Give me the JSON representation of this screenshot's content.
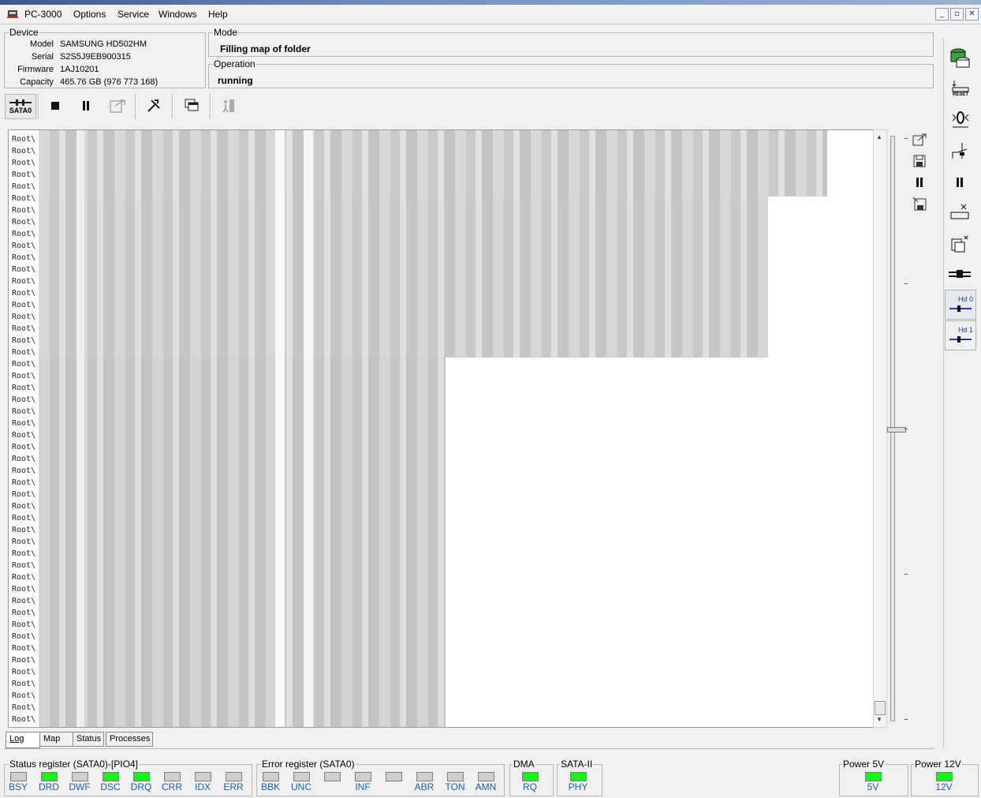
{
  "app": {
    "title": "PC-3000"
  },
  "menu": [
    "Options",
    "Service",
    "Windows",
    "Help"
  ],
  "window_buttons": [
    "_",
    "▫",
    "✕"
  ],
  "device": {
    "legend": "Device",
    "fields": [
      {
        "key": "Model",
        "value": "SAMSUNG HD502HM"
      },
      {
        "key": "Serial",
        "value": "S2S5J9EB900315"
      },
      {
        "key": "Firmware",
        "value": "1AJ10201"
      },
      {
        "key": "Capacity",
        "value": "465.76 GB (976 773 168)"
      }
    ]
  },
  "mode": {
    "legend": "Mode",
    "value": "Filling map of folder"
  },
  "operation": {
    "legend": "Operation",
    "value": "running"
  },
  "toolbar": {
    "port_label": "SATA0",
    "icons": [
      "sata-port-icon",
      "stop-icon",
      "pause-icon",
      "export-icon",
      "tools-icon",
      "windows-icon",
      "exit-icon"
    ]
  },
  "log": {
    "line_prefix": "Root\\",
    "line_count": 50
  },
  "tabs": [
    "Log",
    "Map",
    "Status",
    "Processes"
  ],
  "right_panel": {
    "hd0": "Hd 0",
    "hd1": "Hd 1",
    "reset": "RESET"
  },
  "status_register": {
    "legend": "Status register (SATA0)-[PIO4]",
    "leds": [
      {
        "label": "BSY",
        "on": false
      },
      {
        "label": "DRD",
        "on": true
      },
      {
        "label": "DWF",
        "on": false
      },
      {
        "label": "DSC",
        "on": true
      },
      {
        "label": "DRQ",
        "on": true
      },
      {
        "label": "CRR",
        "on": false
      },
      {
        "label": "IDX",
        "on": false
      },
      {
        "label": "ERR",
        "on": false
      }
    ]
  },
  "error_register": {
    "legend": "Error register (SATA0)",
    "leds": [
      {
        "label": "BBK",
        "on": false
      },
      {
        "label": "UNC",
        "on": false
      },
      {
        "label": "",
        "on": false
      },
      {
        "label": "INF",
        "on": false
      },
      {
        "label": "",
        "on": false
      },
      {
        "label": "ABR",
        "on": false
      },
      {
        "label": "TON",
        "on": false
      },
      {
        "label": "AMN",
        "on": false
      }
    ]
  },
  "dma": {
    "legend": "DMA",
    "label": "RQ",
    "on": true
  },
  "sata2": {
    "legend": "SATA-II",
    "label": "PHY",
    "on": true
  },
  "power5": {
    "legend": "Power 5V",
    "label": "5V",
    "on": true
  },
  "power12": {
    "legend": "Power 12V",
    "label": "12V",
    "on": true
  },
  "colors": {
    "led_on": "#19f019",
    "led_off": "#cfcfcf",
    "label_blue": "#1e5ca8"
  }
}
